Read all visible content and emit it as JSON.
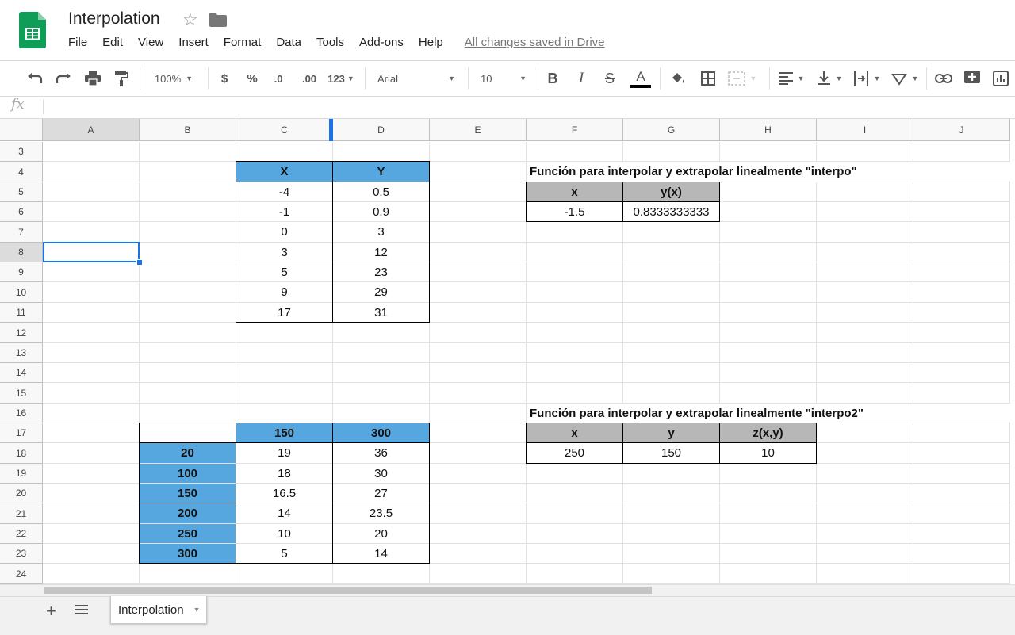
{
  "app": {
    "title": "Interpolation",
    "menu": [
      "File",
      "Edit",
      "View",
      "Insert",
      "Format",
      "Data",
      "Tools",
      "Add-ons",
      "Help"
    ],
    "save_status": "All changes saved in Drive"
  },
  "toolbar": {
    "zoom": "100%",
    "currency": "$",
    "percent": "%",
    "dec_decrease": ".0",
    "dec_increase": ".00",
    "more_formats": "123",
    "font": "Arial",
    "font_size": "10",
    "bold": "B",
    "italic": "I",
    "strike": "S",
    "text_color_letter": "A"
  },
  "formula_bar": {
    "fx": "fx",
    "value": ""
  },
  "grid": {
    "columns": [
      "A",
      "B",
      "C",
      "D",
      "E",
      "F",
      "G",
      "H",
      "I",
      "J"
    ],
    "rows": [
      "3",
      "4",
      "5",
      "6",
      "7",
      "8",
      "9",
      "10",
      "11",
      "12",
      "13",
      "14",
      "15",
      "16",
      "17",
      "18",
      "19",
      "20",
      "21",
      "22",
      "23",
      "24"
    ],
    "selected_cell": "A8"
  },
  "table1": {
    "headers": [
      "X",
      "Y"
    ],
    "rows": [
      [
        "-4",
        "0.5"
      ],
      [
        "-1",
        "0.9"
      ],
      [
        "0",
        "3"
      ],
      [
        "3",
        "12"
      ],
      [
        "5",
        "23"
      ],
      [
        "9",
        "29"
      ],
      [
        "17",
        "31"
      ]
    ]
  },
  "fn1": {
    "title": "Función para interpolar y extrapolar linealmente \"interpo\"",
    "headers": [
      "x",
      "y(x)"
    ],
    "values": [
      "-1.5",
      "0.8333333333"
    ]
  },
  "table2": {
    "col_headers": [
      "150",
      "300"
    ],
    "row_headers": [
      "20",
      "100",
      "150",
      "200",
      "250",
      "300"
    ],
    "rows": [
      [
        "19",
        "36"
      ],
      [
        "18",
        "30"
      ],
      [
        "16.5",
        "27"
      ],
      [
        "14",
        "23.5"
      ],
      [
        "10",
        "20"
      ],
      [
        "5",
        "14"
      ]
    ]
  },
  "fn2": {
    "title": "Función para interpolar y extrapolar linealmente \"interpo2\"",
    "headers": [
      "x",
      "y",
      "z(x,y)"
    ],
    "values": [
      "250",
      "150",
      "10"
    ]
  },
  "sheets": {
    "add": "+",
    "tabs": [
      "Interpolation"
    ]
  },
  "colors": {
    "header_blue": "#56a7e0",
    "header_gray": "#b7b7b7",
    "selection": "#1a73e8",
    "sheets_green": "#0f9d58"
  }
}
